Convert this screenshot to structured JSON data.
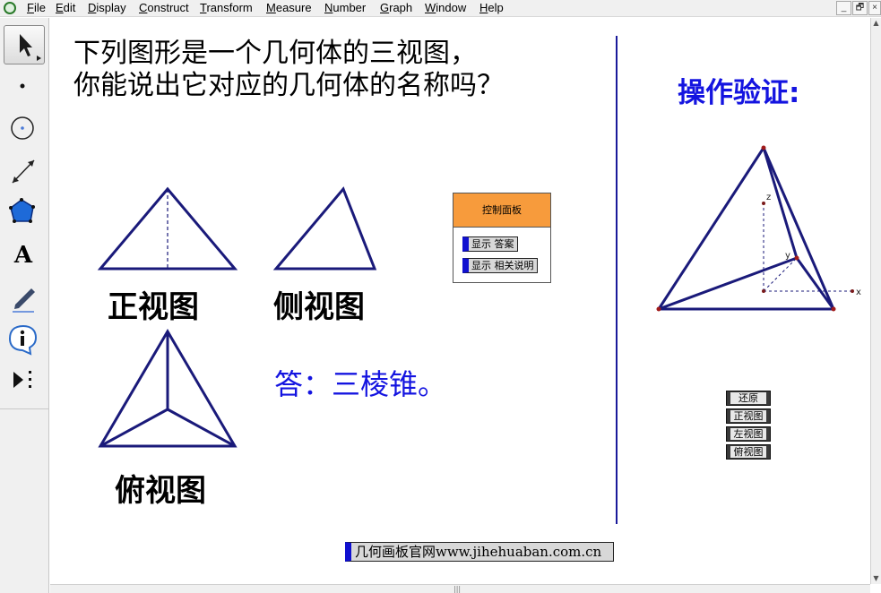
{
  "menubar": {
    "items": [
      "File",
      "Edit",
      "Display",
      "Construct",
      "Transform",
      "Measure",
      "Number",
      "Graph",
      "Window",
      "Help"
    ],
    "window_buttons": [
      "_",
      "🗗",
      "×"
    ]
  },
  "toolbox": {
    "tools": [
      "arrow-select-tool",
      "point-tool",
      "compass-tool",
      "straightedge-tool",
      "polygon-tool",
      "text-tool",
      "marker-tool",
      "information-tool",
      "custom-tools"
    ],
    "text_tool_glyph": "A"
  },
  "canvas": {
    "question_line1": "下列图形是一个几何体的三视图，",
    "question_line2": "你能说出它对应的几何体的名称吗？",
    "front_view_label": "正视图",
    "side_view_label": "侧视图",
    "top_view_label": "俯视图",
    "answer": "答：三棱锥。",
    "verify_title": "操作验证:",
    "axis_labels": {
      "x": "x",
      "y": "y",
      "z": "z"
    },
    "stroke_color": "#1a1a7a",
    "accent_color": "#1414e0"
  },
  "control_panel": {
    "title": "控制面板",
    "show_answer": "显示 答案",
    "show_explanation": "显示 相关说明"
  },
  "view_buttons": [
    "还原",
    "正视图",
    "左视图",
    "俯视图"
  ],
  "website": "几何画板官网www.jihehuaban.com.cn"
}
